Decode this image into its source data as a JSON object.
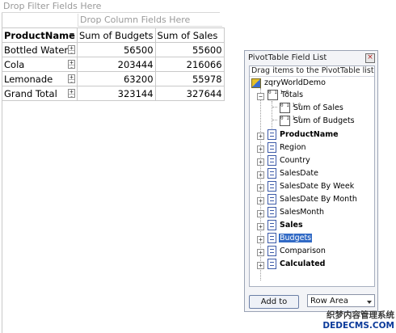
{
  "pivot": {
    "filter_drop_label": "Drop Filter Fields Here",
    "column_drop_label": "Drop Column Fields Here",
    "row_header": "ProductName",
    "value_headers": [
      "Sum of Budgets",
      "Sum of Sales"
    ],
    "rows": [
      {
        "label": "Bottled Water",
        "budgets": "56500",
        "sales": "55600"
      },
      {
        "label": "Cola",
        "budgets": "203444",
        "sales": "216066"
      },
      {
        "label": "Lemonade",
        "budgets": "63200",
        "sales": "55978"
      },
      {
        "label": "Grand Total",
        "budgets": "323144",
        "sales": "327644"
      }
    ]
  },
  "field_list": {
    "title": "PivotTable Field List",
    "close_glyph": "×",
    "drag_hint": "Drag items to the PivotTable list",
    "root": "zqryWorldDemo",
    "totals": "Totals",
    "measures": [
      "Sum of Sales",
      "Sum of Budgets"
    ],
    "measure_icon_text": "0 1 1 0",
    "fields": [
      {
        "label": "ProductName",
        "bold": true
      },
      {
        "label": "Region",
        "bold": false
      },
      {
        "label": "Country",
        "bold": false
      },
      {
        "label": "SalesDate",
        "bold": false
      },
      {
        "label": "SalesDate By Week",
        "bold": false
      },
      {
        "label": "SalesDate By Month",
        "bold": false
      },
      {
        "label": "SalesMonth",
        "bold": false
      },
      {
        "label": "Sales",
        "bold": true
      },
      {
        "label": "Budgets",
        "bold": false,
        "selected": true
      },
      {
        "label": "Comparison",
        "bold": false
      },
      {
        "label": "Calculated",
        "bold": true
      }
    ],
    "add_button": "Add to",
    "area_value": "Row Area"
  },
  "watermark": {
    "line1": "织梦内容管理系统",
    "line2": "DEDECMS.COM"
  },
  "colors": {
    "selection": "#316ac5",
    "panel_bg": "#f3f4f7",
    "hint_text": "#9a9a9a"
  }
}
